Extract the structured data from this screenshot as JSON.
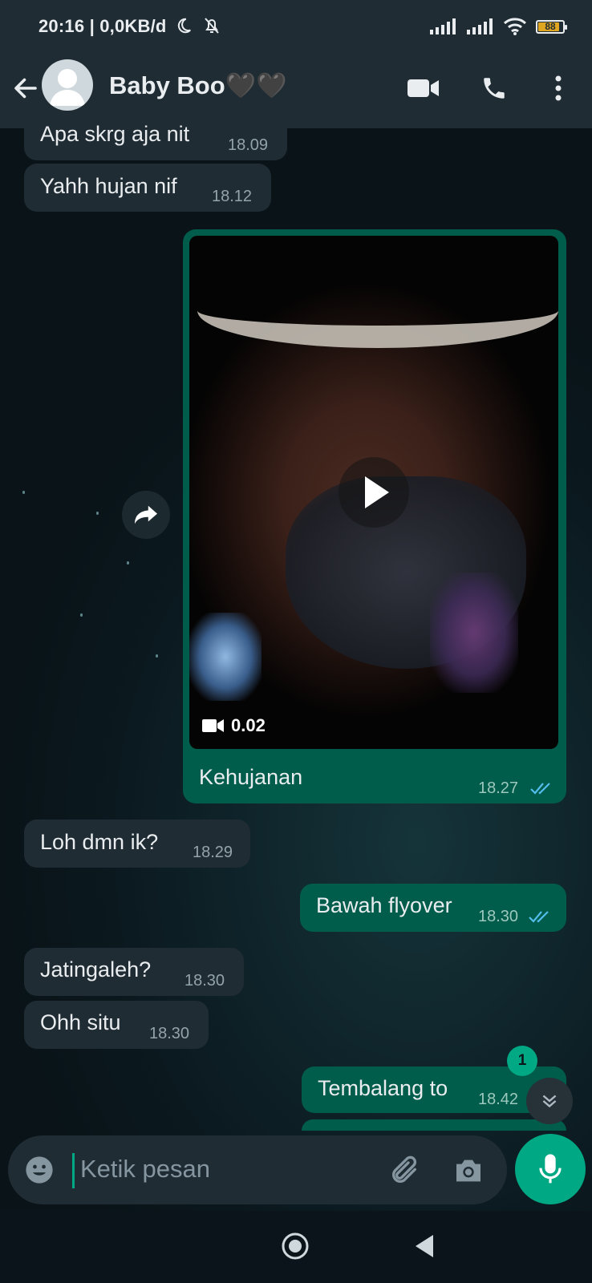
{
  "status_bar": {
    "time": "20:16 | 0,0KB/d",
    "battery": "88",
    "battery_level_percent": 88
  },
  "header": {
    "contact_name": "Baby Boo🖤🖤",
    "icons": [
      "back-arrow-icon",
      "avatar-placeholder-icon",
      "video-call-icon",
      "phone-icon",
      "more-vert-icon"
    ]
  },
  "messages": [
    {
      "dir": "in",
      "text": "Apa skrg aja nit",
      "time": "18.09"
    },
    {
      "dir": "in",
      "text": "Yahh hujan nif",
      "time": "18.12"
    },
    {
      "dir": "out",
      "type": "video",
      "duration": "0.02",
      "caption": "Kehujanan",
      "time": "18.27",
      "status": "read"
    },
    {
      "dir": "in",
      "text": "Loh dmn ik?",
      "time": "18.29"
    },
    {
      "dir": "out",
      "text": "Bawah flyover",
      "time": "18.30",
      "status": "read"
    },
    {
      "dir": "in",
      "text": "Jatingaleh?",
      "time": "18.30"
    },
    {
      "dir": "in",
      "text": "Ohh situ",
      "time": "18.30"
    },
    {
      "dir": "out",
      "text": "Tembalang to",
      "time": "18.42"
    }
  ],
  "unread_count": "1",
  "composer": {
    "placeholder": "Ketik pesan"
  },
  "colors": {
    "incoming_bubble": "#202c33",
    "outgoing_bubble": "#005c4b",
    "accent": "#00a884",
    "read_ticks": "#53bdeb"
  }
}
